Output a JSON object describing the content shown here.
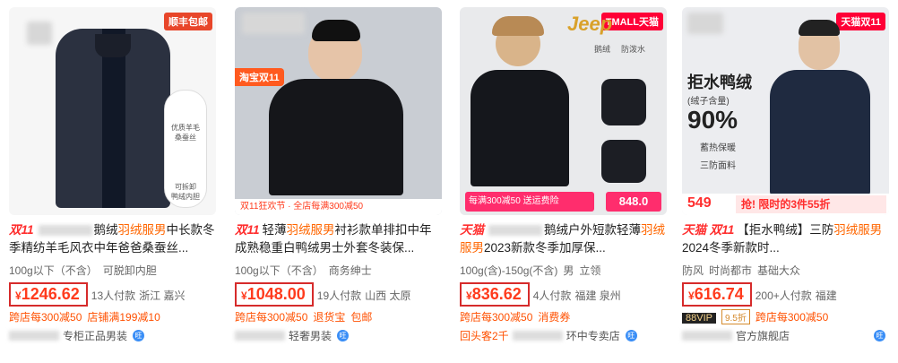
{
  "products": [
    {
      "badge": "顺丰包邮",
      "img_inset_labels": [
        "优质羊毛",
        "桑蚕丝",
        "可拆卸",
        "鸭绒内胆"
      ],
      "tag": "双11",
      "title_a": "鹅绒",
      "title_hl": "羽绒服男",
      "title_b": "中长款冬季精纺羊毛风衣中年爸爸桑蚕丝...",
      "attrs": [
        "100g以下（不含）",
        "可脱卸内胆"
      ],
      "price": "1246.62",
      "sales": "13人付款",
      "location": "浙江 嘉兴",
      "promos": [
        "跨店每300减50",
        "店铺满199减10"
      ],
      "shop": "专柜正品男装",
      "shop_icon": "旺"
    },
    {
      "badge": "淘宝双11",
      "img_banner": "双11狂欢节 · 全店每满300减50",
      "tag": "双11",
      "title_a": "轻薄",
      "title_hl": "羽绒服男",
      "title_b": "衬衫款单排扣中年成熟稳重白鸭绒男士外套冬装保...",
      "attrs": [
        "100g以下（不含）",
        "商务绅士"
      ],
      "price": "1048.00",
      "sales": "19人付款",
      "location": "山西 太原",
      "promos": [
        "跨店每300减50",
        "退货宝",
        "包邮"
      ],
      "shop": "轻奢男装",
      "shop_icon": "旺"
    },
    {
      "badge": "TMALL天猫",
      "brand": "Jeep",
      "img_icons": [
        "鹅绒",
        "防泼水"
      ],
      "img_promo_a": "每满300减50 送运费险",
      "img_promo_price": "848.0",
      "tag": "天猫",
      "title_a": "鹅绒户外短款轻薄",
      "title_hl": "羽绒服男",
      "title_b": "2023新款冬季加厚保...",
      "attrs": [
        "100g(含)-150g(不含)",
        "男",
        "立领"
      ],
      "price": "836.62",
      "sales": "4人付款",
      "location": "福建 泉州",
      "promos": [
        "跨店每300减50",
        "消费券"
      ],
      "promo_extra": "回头客2千",
      "shop": "环中专卖店",
      "shop_icon": "旺"
    },
    {
      "badge": "天猫双11",
      "img_title": "拒水鸭绒",
      "img_sub": "(绒子含量)",
      "img_pct": "90%",
      "img_feats": [
        "蓄热保暖",
        "三防面料"
      ],
      "img_footer_price": "549",
      "img_footer_text": "抢! 限时的3件55折",
      "tag": "天猫 双11",
      "title_a": "【拒水鸭绒】三防",
      "title_hl": "羽绒服男",
      "title_b": "2024冬季新款时...",
      "attrs": [
        "防风",
        "时尚都市",
        "基础大众"
      ],
      "price": "616.74",
      "sales": "200+人付款",
      "location": "福建",
      "vip": "88VIP",
      "vip_price": "9.5折",
      "promos": [
        "跨店每300减50"
      ],
      "shop": "官方旗舰店",
      "shop_icon": "旺"
    }
  ]
}
